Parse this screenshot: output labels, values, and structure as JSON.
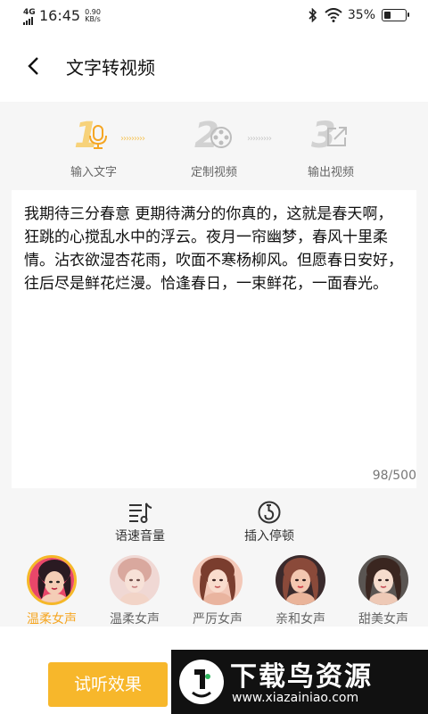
{
  "status_bar": {
    "network": "4G",
    "time": "16:45",
    "speed_value": "0.90",
    "speed_unit": "KB/s",
    "battery_text": "35%",
    "battery_level": 0.35
  },
  "header": {
    "title": "文字转视频"
  },
  "steps": [
    {
      "number": "1",
      "label": "输入文字",
      "icon": "microphone-icon",
      "active": true
    },
    {
      "number": "2",
      "label": "定制视频",
      "icon": "film-reel-icon",
      "active": false
    },
    {
      "number": "3",
      "label": "输出视频",
      "icon": "export-icon",
      "active": false
    }
  ],
  "text_input": {
    "content": "我期待三分春意 更期待满分的你真的，这就是春天啊，狂跳的心搅乱水中的浮云。夜月一帘幽梦，春风十里柔情。沾衣欲湿杏花雨，吹面不寒杨柳风。但愿春日安好，往后尽是鲜花烂漫。恰逢春日，一束鲜花，一面春光。",
    "counter": "98/500"
  },
  "tools": {
    "speed_volume": "语速音量",
    "insert_pause": "插入停顿"
  },
  "voices": [
    {
      "label": "温柔女声",
      "selected": true
    },
    {
      "label": "温柔女声",
      "selected": false
    },
    {
      "label": "严厉女声",
      "selected": false
    },
    {
      "label": "亲和女声",
      "selected": false
    },
    {
      "label": "甜美女声",
      "selected": false
    }
  ],
  "bottom": {
    "listen_button": "试听效果",
    "watermark_title": "下载鸟资源",
    "watermark_url": "www.xiazainiao.com"
  },
  "colors": {
    "accent": "#f7b72b",
    "accent_text": "#f5a623",
    "inactive_step": "#c8c8c8"
  }
}
